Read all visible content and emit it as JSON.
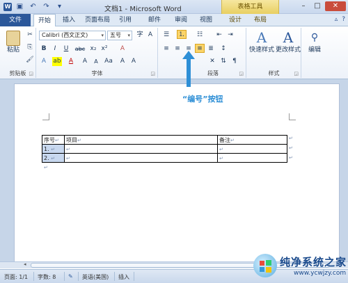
{
  "window": {
    "title": "文档1 - Microsoft Word",
    "context_tab_group": "表格工具",
    "app_icon_letter": "W"
  },
  "qat": {
    "save_icon": "save-icon",
    "undo_icon": "undo-icon",
    "redo_icon": "redo-icon",
    "customize_icon": "customize-icon"
  },
  "tabs": [
    "文件",
    "开始",
    "插入",
    "页面布局",
    "引用",
    "邮件",
    "审阅",
    "视图",
    "设计",
    "布局"
  ],
  "ribbon": {
    "clipboard": {
      "label": "剪贴板",
      "paste": "粘贴"
    },
    "font": {
      "label": "字体",
      "font_name": "Calibri (西文正文)",
      "font_size": "五号",
      "bold": "B",
      "italic": "I",
      "underline": "U",
      "strike": "abc",
      "subscript": "x₂",
      "superscript": "x²",
      "clear_format": "A",
      "grow_font": "A",
      "shrink_font": "A",
      "change_case": "Aa",
      "phonetic": "wén",
      "enclose": "字"
    },
    "paragraph": {
      "label": "段落"
    },
    "styles": {
      "label": "样式",
      "quick_styles": "快速样式",
      "change_styles": "更改样式"
    },
    "editing": {
      "label": "编辑",
      "edit": "编辑"
    }
  },
  "annotation": {
    "text": "“编号”按钮"
  },
  "document": {
    "table": {
      "headers": [
        "序号",
        "项目",
        "备注"
      ],
      "rows": [
        {
          "num": "1.",
          "item": "",
          "note": ""
        },
        {
          "num": "2.",
          "item": "",
          "note": ""
        }
      ]
    },
    "paragraph_mark": "↵"
  },
  "statusbar": {
    "page": "页面: 1/1",
    "words": "字数: 8",
    "language": "英语(美国)",
    "mode": "插入"
  },
  "watermark": {
    "brand": "纯净系统之家",
    "url": "www.ycwjzy.com"
  },
  "colors": {
    "file_tab": "#2b579a",
    "accent_annotation": "#2e8fd6",
    "table_tools": "#e8cf62"
  }
}
